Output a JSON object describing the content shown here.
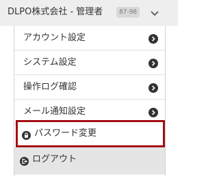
{
  "header": {
    "title": "DLPO株式会社 - 管理者",
    "badge": "87-98",
    "toggle_icon": "chevron-down-icon"
  },
  "menu": {
    "items": [
      {
        "label": "アカウント設定",
        "icon": "chevron-right-circle-icon"
      },
      {
        "label": "システム設定",
        "icon": "chevron-right-circle-icon"
      },
      {
        "label": "操作ログ確認",
        "icon": "chevron-right-circle-icon"
      },
      {
        "label": "メール通知設定",
        "icon": "chevron-right-circle-icon"
      }
    ],
    "password": {
      "label": "パスワード変更",
      "icon": "lock-icon"
    },
    "logout": {
      "label": "ログアウト",
      "icon": "logout-icon"
    }
  },
  "colors": {
    "highlight_border": "#a30f12",
    "header_bg": "#eeeeee",
    "logout_bg": "#e5e5e5",
    "icon_fill": "#333333"
  }
}
